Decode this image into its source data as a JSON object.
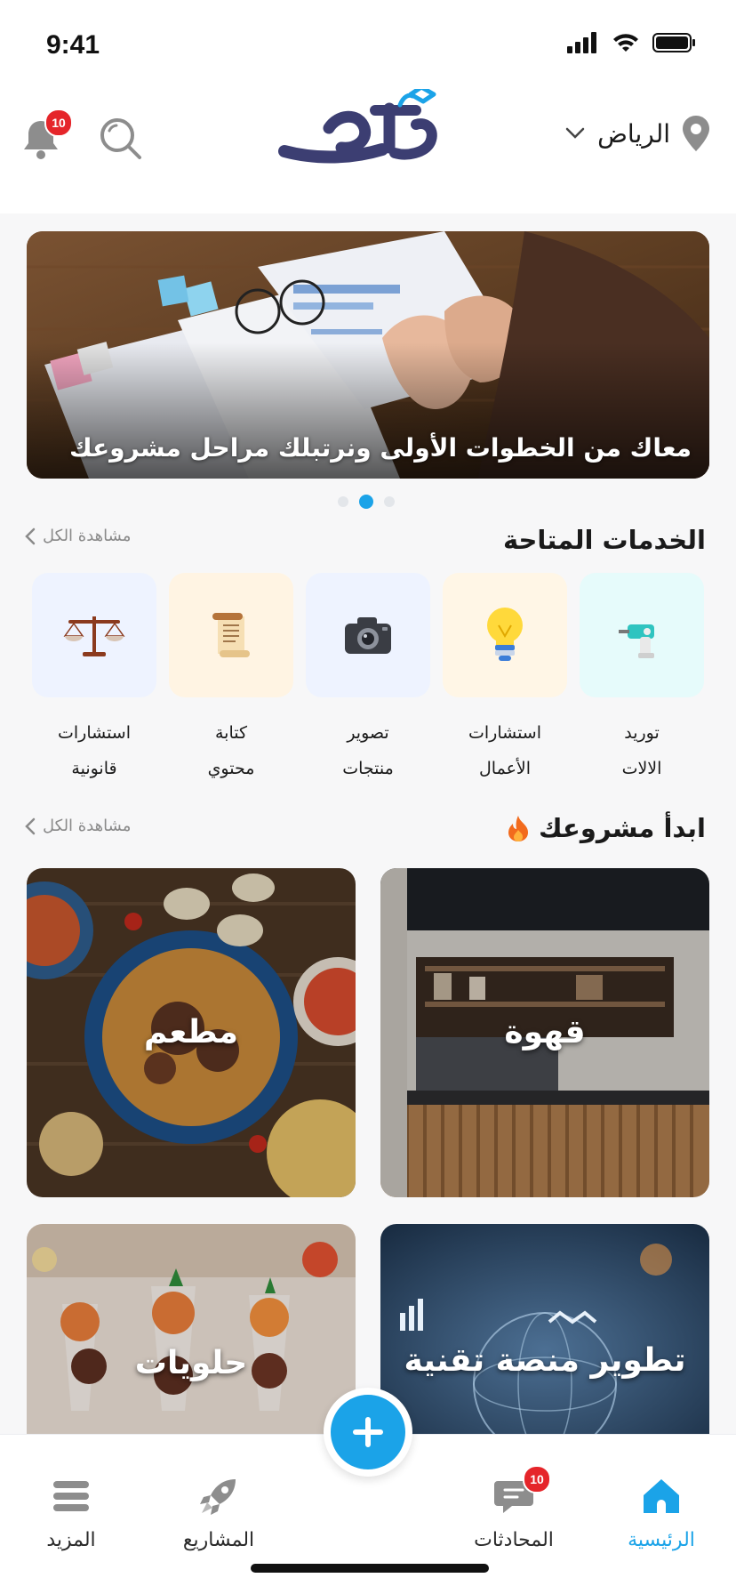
{
  "status_bar": {
    "time": "9:41"
  },
  "header": {
    "location": "الرياض",
    "notifications_count": "10",
    "logo_icon": "brand-logo"
  },
  "banner": {
    "caption": "معاك من الخطوات الأولى ونرتبلك مراحل مشروعك",
    "page_index": 2,
    "page_count": 3
  },
  "services_section": {
    "title": "الخدمات المتاحة",
    "see_all": "مشاهدة الكل",
    "items": [
      {
        "line1": "توريد",
        "line2": "الالات",
        "icon": "drill-icon",
        "bg": "#e6fbfb"
      },
      {
        "line1": "استشارات",
        "line2": "الأعمال",
        "icon": "lightbulb-icon",
        "bg": "#fff6e6"
      },
      {
        "line1": "تصوير",
        "line2": "منتجات",
        "icon": "camera-icon",
        "bg": "#eef3ff"
      },
      {
        "line1": "كتابة",
        "line2": "محتوي",
        "icon": "scroll-icon",
        "bg": "#fff4e3"
      },
      {
        "line1": "استشارات",
        "line2": "قانونية",
        "icon": "scales-icon",
        "bg": "#eef3ff"
      }
    ]
  },
  "projects_section": {
    "title": "ابدأ مشروعك",
    "see_all": "مشاهدة الكل",
    "cards": [
      {
        "title": "قهوة"
      },
      {
        "title": "مطعم"
      },
      {
        "title": "تطوير منصة تقنية"
      },
      {
        "title": "حلويات"
      }
    ]
  },
  "bottom_nav": {
    "items": [
      {
        "label": "الرئيسية",
        "icon": "home-icon",
        "active": true
      },
      {
        "label": "المحادثات",
        "icon": "chat-icon",
        "badge": "10"
      },
      {
        "label": "المشاريع",
        "icon": "rocket-icon"
      },
      {
        "label": "المزيد",
        "icon": "menu-icon"
      }
    ]
  },
  "colors": {
    "accent": "#1ba3e8",
    "brand_dark": "#3c3e72",
    "badge": "#e5252a"
  }
}
